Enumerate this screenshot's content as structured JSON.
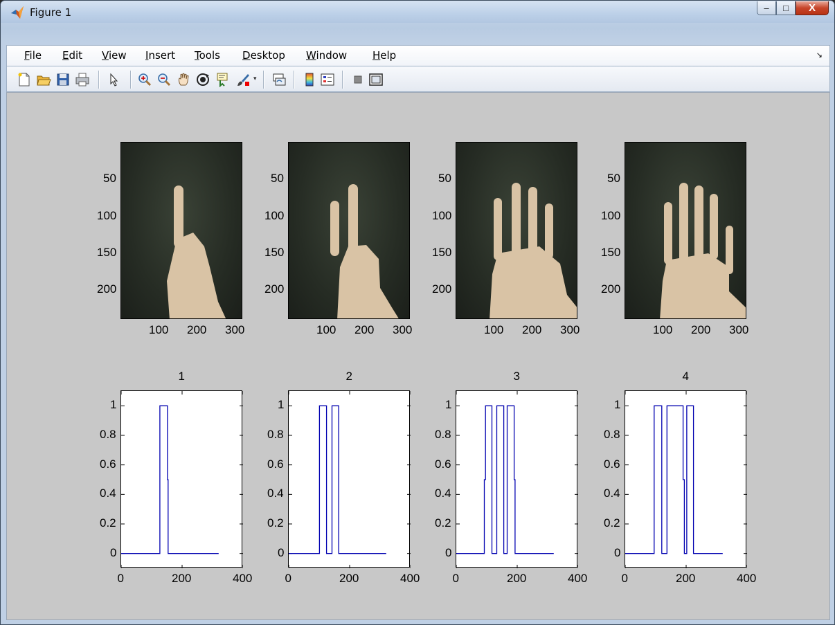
{
  "window": {
    "title": "Figure 1",
    "minimize_label": "–",
    "maximize_label": "□",
    "close_label": "X"
  },
  "menu": [
    {
      "label": "File"
    },
    {
      "label": "Edit"
    },
    {
      "label": "View"
    },
    {
      "label": "Insert"
    },
    {
      "label": "Tools"
    },
    {
      "label": "Desktop"
    },
    {
      "label": "Window"
    },
    {
      "label": "Help"
    }
  ],
  "menu_overflow_icon": "dock-arrow-icon",
  "toolbar": {
    "icons": [
      "new-figure-icon",
      "open-file-icon",
      "save-icon",
      "print-icon",
      "select-arrow-icon",
      "zoom-in-icon",
      "zoom-out-icon",
      "pan-icon",
      "rotate-3d-icon",
      "data-cursor-icon",
      "brush-icon",
      "link-plot-icon",
      "colorbar-icon",
      "legend-icon",
      "hide-plot-tools-icon",
      "show-plot-tools-icon"
    ]
  },
  "image_axes": {
    "y_ticks": [
      "50",
      "100",
      "150",
      "200"
    ],
    "x_ticks": [
      "100",
      "200",
      "300"
    ],
    "panels": [
      {
        "fingers": 1
      },
      {
        "fingers": 2
      },
      {
        "fingers": 4
      },
      {
        "fingers": 5
      }
    ]
  },
  "chart_data": [
    {
      "type": "line",
      "title": "1",
      "xlim": [
        0,
        400
      ],
      "ylim": [
        -0.1,
        1.1
      ],
      "x_ticks": [
        "0",
        "200",
        "400"
      ],
      "y_ticks": [
        "0",
        "0.2",
        "0.4",
        "0.6",
        "0.8",
        "1"
      ],
      "series": [
        {
          "x": [
            0,
            127,
            127,
            131,
            131,
            152,
            152,
            154,
            154,
            159,
            159,
            320
          ],
          "y": [
            0,
            0,
            1,
            1,
            1,
            1,
            0.5,
            0.5,
            0,
            0,
            0,
            0
          ]
        }
      ],
      "color": "#0000b0"
    },
    {
      "type": "line",
      "title": "2",
      "xlim": [
        0,
        400
      ],
      "ylim": [
        -0.1,
        1.1
      ],
      "x_ticks": [
        "0",
        "200",
        "400"
      ],
      "y_ticks": [
        "0",
        "0.2",
        "0.4",
        "0.6",
        "0.8",
        "1"
      ],
      "series": [
        {
          "x": [
            0,
            101,
            101,
            124,
            124,
            142,
            142,
            164,
            164,
            320
          ],
          "y": [
            0,
            0,
            1,
            1,
            0,
            0,
            1,
            1,
            0,
            0
          ]
        }
      ],
      "color": "#0000b0"
    },
    {
      "type": "line",
      "title": "3",
      "xlim": [
        0,
        400
      ],
      "ylim": [
        -0.1,
        1.1
      ],
      "x_ticks": [
        "0",
        "200",
        "400"
      ],
      "y_ticks": [
        "0",
        "0.2",
        "0.4",
        "0.6",
        "0.8",
        "1"
      ],
      "series": [
        {
          "x": [
            0,
            92,
            92,
            96,
            96,
            117,
            117,
            133,
            133,
            156,
            156,
            167,
            167,
            190,
            190,
            193,
            193,
            198,
            198,
            320
          ],
          "y": [
            0,
            0,
            0.5,
            0.5,
            1,
            1,
            0,
            0,
            1,
            1,
            0,
            0,
            1,
            1,
            0.5,
            0.5,
            0,
            0,
            0,
            0
          ]
        }
      ],
      "color": "#0000b0"
    },
    {
      "type": "line",
      "title": "4",
      "xlim": [
        0,
        400
      ],
      "ylim": [
        -0.1,
        1.1
      ],
      "x_ticks": [
        "0",
        "200",
        "400"
      ],
      "y_ticks": [
        "0",
        "0.2",
        "0.4",
        "0.6",
        "0.8",
        "1"
      ],
      "series": [
        {
          "x": [
            0,
            95,
            95,
            120,
            120,
            137,
            137,
            162,
            162,
            168,
            168,
            190,
            190,
            194,
            194,
            202,
            202,
            224,
            224,
            320
          ],
          "y": [
            0,
            0,
            1,
            1,
            0,
            0,
            1,
            1,
            1,
            1,
            1,
            1,
            0.5,
            0.5,
            0,
            0,
            1,
            1,
            0,
            0
          ]
        }
      ],
      "color": "#0000b0"
    }
  ]
}
